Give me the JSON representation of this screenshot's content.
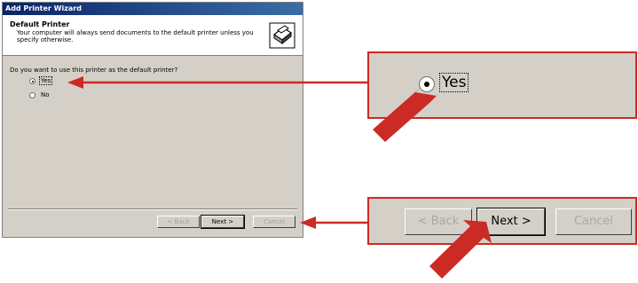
{
  "wizard": {
    "title": "Add Printer Wizard",
    "header_title": "Default Printer",
    "header_desc": "Your computer will always send documents to the default printer unless you specify otherwise.",
    "question": "Do you want to use this printer as the default printer?",
    "options": [
      {
        "label": "Yes",
        "selected": true
      },
      {
        "label": "No",
        "selected": false
      }
    ],
    "buttons": {
      "back": "< Back",
      "next": "Next >",
      "cancel": "Cancel"
    }
  },
  "callout_top": {
    "option_label": "Yes"
  },
  "callout_bottom": {
    "back": "< Back",
    "next": "Next >",
    "cancel": "Cancel"
  },
  "colors": {
    "accent": "#cc2a24",
    "dialog": "#d4d0c8",
    "titlebar": "#0a246a"
  },
  "icons": [
    "printer-icon",
    "arrow-icon",
    "pointer-arrow-icon"
  ]
}
